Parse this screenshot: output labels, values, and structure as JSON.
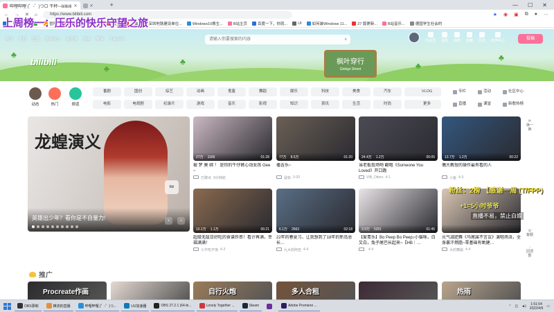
{
  "browser": {
    "tabs": [
      {
        "label": "哔哩哔哩 (゜-゜)つロ 干杯~-bilibili",
        "active": true
      },
      {
        "label": "",
        "active": false
      }
    ],
    "url": "https://www.bilibili.com",
    "bookmarks": [
      "",
      "100%",
      "",
      "冒险",
      "哔哩哔哩 (゜-゜)つ...",
      "淘宝",
      "天猫",
      "深圳地铁建设单位...",
      "Windows10换生...",
      "B站主页",
      "百度一下，你就...",
      "UI",
      "如何装Windows 11...",
      "27 版更新...",
      "B站音乐...",
      "德国学生社会的"
    ]
  },
  "stream_overlay": {
    "title": "上周榜一：压乐的快乐守望之旅",
    "danmaku": [
      "粉丝：2榜 【感谢一周 (T/FPP)",
      "+1=5小时爷爷",
      "直播不易，禁止白嫖"
    ]
  },
  "site": {
    "nav": [
      "首页",
      "番剧",
      "直播",
      "游戏中心",
      "会员购",
      "漫画",
      "赛事",
      "下载APP"
    ],
    "search_placeholder": "请输入你要搜索的内容",
    "user_icons": [
      "大会员",
      "消息",
      "动态",
      "收藏",
      "历史",
      "创作中心"
    ],
    "upload_label": "投稿",
    "logo": "bilibili",
    "sign_title": "枫叶穿行",
    "sign_sub": "Ginkgo Street"
  },
  "channels": {
    "circles": [
      {
        "label": "动态",
        "color": "#6b5a4e"
      },
      {
        "label": "热门",
        "color": "#fe6f5a"
      },
      {
        "label": "频道",
        "color": "#28c49b"
      }
    ],
    "pills": [
      "番剧",
      "国创",
      "综艺",
      "动画",
      "鬼畜",
      "舞蹈",
      "娱乐",
      "科技",
      "美食",
      "汽车",
      "运动",
      "电影",
      "电视剧",
      "纪录片",
      "游戏",
      "音乐",
      "影视",
      "知识",
      "资讯",
      "生活",
      "时尚",
      "动物圈"
    ],
    "more": "更多",
    "side": [
      "专栏",
      "活动",
      "社区中心",
      "直播",
      "课堂",
      "新歌热榜"
    ],
    "vlog": "VLOG"
  },
  "carousel": {
    "game_title": "龙蝗演义",
    "caption": "英雄出少年？看你是不自量力!",
    "badge": "Bili",
    "slide_count": 10,
    "active_slide": 0
  },
  "videos": [
    {
      "views": "27万",
      "danmaku": "1169",
      "duration": "01:28",
      "title": "被 梦 莫 绑 ！ 是你的牛仔裤心动女孩 Gee ~",
      "up": "已蹲点",
      "date": "9分钟前",
      "thumb": "#cbb8c2"
    },
    {
      "views": "77万",
      "danmaku": "8.5万",
      "duration": "01:20",
      "title": "播吉乐~",
      "up": "鼠标",
      "date": "3-20",
      "thumb": "#6b6056"
    },
    {
      "views": "24.4万",
      "danmaku": "1.2万",
      "duration": "05:05",
      "title": "当老板现场吻 翻唱《Someone You Loved》开口跪",
      "up": "VIB_Otters",
      "date": "4-1",
      "thumb": "#4c4b55"
    },
    {
      "views": "13.7万",
      "danmaku": "1.2万",
      "duration": "00:22",
      "title": "偶大教授的操作最有看的人",
      "up": "小鱼",
      "date": "4-3",
      "thumb": "#33577e"
    },
    {
      "views": "10.1万",
      "danmaku": "1.1万",
      "duration": "06:21",
      "title": "超级无敌日好吃的食谱炸串！看计再满，幸福满满！",
      "up": "小不吃不饱",
      "date": "4-3",
      "thumb": "#8a6a4f"
    },
    {
      "views": "6.1万",
      "danmaku": "2663",
      "duration": "02:18",
      "title": "22年的春夏习，让我想到了18年的新岛总长…",
      "up": "九大的阿吉",
      "date": "4-4",
      "thumb": "#5a6f86"
    },
    {
      "views": "3.9万",
      "danmaku": "5201",
      "duration": "01:45",
      "title": "【爱青乐】Bo Peep Bo Peep♪小猫咪，白又白，兔子尾巴长起来~【HB｜…",
      "up": "",
      "date": "4-4",
      "thumb": "#e9e4e6"
    },
    {
      "views": "",
      "danmaku": "",
      "duration": "",
      "title": "元气减肥舞《马尾属不言议》演唱场派，全身暴汗燃脂~零基础有氧健…",
      "up": "大的舞蹈",
      "date": "4-4",
      "thumb": "#d9c6b4"
    }
  ],
  "float_buttons": [
    "换一换",
    "客服",
    "回顶部"
  ],
  "promo_heading": "推广",
  "bottom_tiles": [
    {
      "label": "Procreate作画",
      "color": "#2b2b2e"
    },
    {
      "label": "",
      "color": "#e5d9d2"
    },
    {
      "label": "自行火炮",
      "color": "#9a7b59"
    },
    {
      "label": "多人合租",
      "color": "#74533b"
    },
    {
      "label": "",
      "color": "#3d2a35"
    },
    {
      "label": "热雨",
      "color": "#b9a58d"
    }
  ],
  "taskbar": {
    "items": [
      {
        "label": "OBS录制",
        "color": "#333"
      },
      {
        "label": "推流的直播",
        "color": "#e0913d"
      },
      {
        "label": "哔哩哔哩 (゜-゜)つ...",
        "color": "#2a8fd9"
      },
      {
        "label": "UU加速器",
        "color": "#0d7ab8"
      },
      {
        "label": "OBS 27.2.1 (64-bi...",
        "color": "#222"
      },
      {
        "label": "Lonely Together ...",
        "color": "#d6333a"
      },
      {
        "label": "Steam",
        "color": "#1b2838"
      },
      {
        "label": "",
        "color": "#6a2f9a"
      },
      {
        "label": "Adobe Premiere ...",
        "color": "#2c1e5c"
      }
    ],
    "time": "1:51:04",
    "date": "2022/4/9"
  },
  "colors": {
    "accent": "#fb7299",
    "text": "#18191c",
    "muted": "#9499a0"
  }
}
